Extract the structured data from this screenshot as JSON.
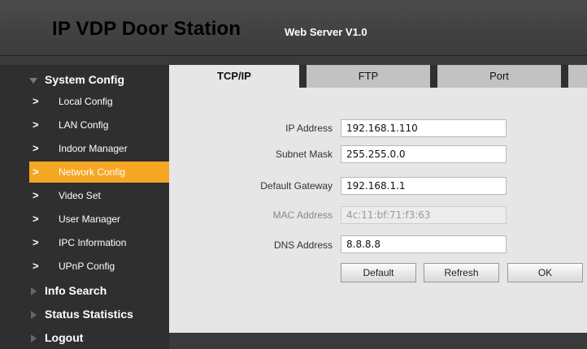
{
  "header": {
    "title": "IP VDP Door Station",
    "subtitle": "Web Server V1.0"
  },
  "sidebar": {
    "system_config": "System Config",
    "items": [
      {
        "label": "Local Config"
      },
      {
        "label": "LAN Config"
      },
      {
        "label": "Indoor Manager"
      },
      {
        "label": "Network Config",
        "active": true
      },
      {
        "label": "Video Set"
      },
      {
        "label": "User Manager"
      },
      {
        "label": "IPC Information"
      },
      {
        "label": "UPnP Config"
      }
    ],
    "info_search": "Info Search",
    "status_statistics": "Status Statistics",
    "logout": "Logout",
    "chevron": ">"
  },
  "tabs": [
    {
      "label": "TCP/IP",
      "active": true
    },
    {
      "label": "FTP"
    },
    {
      "label": "Port"
    }
  ],
  "form": {
    "ip_label": "IP Address",
    "ip_value": "192.168.1.110",
    "subnet_label": "Subnet Mask",
    "subnet_value": "255.255.0.0",
    "gateway_label": "Default Gateway",
    "gateway_value": "192.168.1.1",
    "mac_label": "MAC Address",
    "mac_value": "4c:11:bf:71:f3:63",
    "dns_label": "DNS Address",
    "dns_value": "8.8.8.8"
  },
  "buttons": {
    "default": "Default",
    "refresh": "Refresh",
    "ok": "OK"
  },
  "colors": {
    "accent": "#f5a623",
    "sidebar_bg": "#2f2f2f",
    "content_bg": "#e6e6e6"
  }
}
